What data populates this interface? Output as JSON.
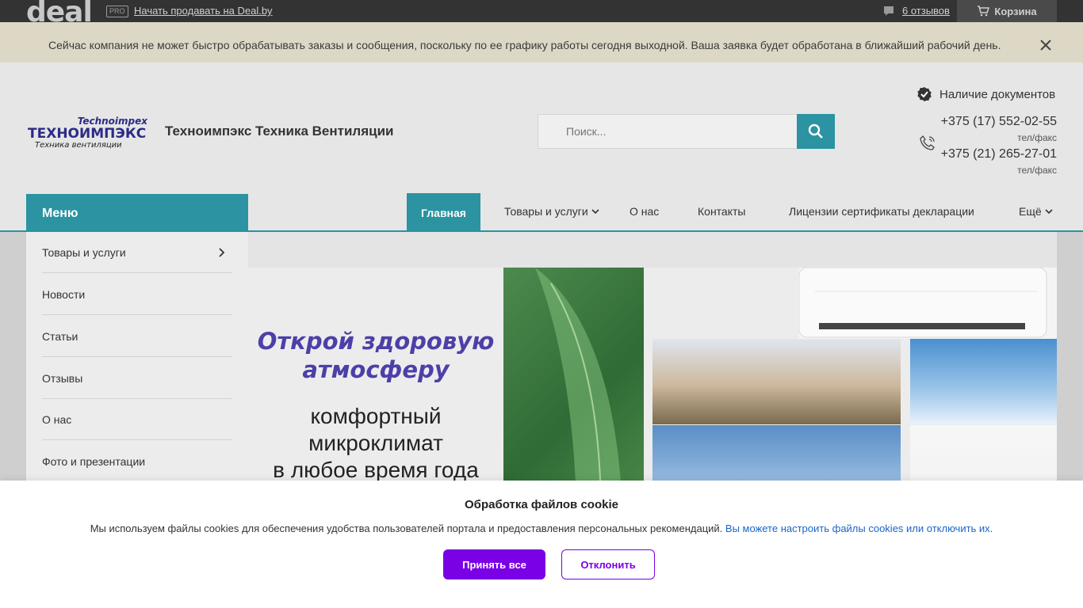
{
  "topbar": {
    "logo": "deal",
    "pro_badge": "PRO",
    "sell_link": "Начать продавать на Deal.by",
    "reviews": "6 отзывов",
    "cart": "Корзина"
  },
  "notice": {
    "text": "Сейчас компания не может быстро обрабатывать заказы и сообщения, поскольку по ее графику работы сегодня выходной. Ваша заявка будет обработана в ближайший рабочий день."
  },
  "header": {
    "logo_line1": "Technoimpex",
    "logo_line2": "ТЕХНОИМПЭКС",
    "logo_line3": "Техника вентиляции",
    "company_name": "Техноимпэкс Техника Вентиляции",
    "search_placeholder": "Поиск...",
    "docs": "Наличие документов",
    "phone1": "+375 (17) 552-02-55",
    "phone1_label": "тел/факс",
    "phone2": "+375 (21) 265-27-01",
    "phone2_label": "тел/факс"
  },
  "nav": {
    "menu": "Меню",
    "items": [
      "Главная",
      "Товары и услуги",
      "О нас",
      "Контакты",
      "Лицензии сертификаты декларации",
      "Ещё"
    ]
  },
  "sidebar": {
    "items": [
      "Товары и услуги",
      "Новости",
      "Статьи",
      "Отзывы",
      "О нас",
      "Фото и презентации"
    ]
  },
  "banner": {
    "title": "Открой здоровую атмосферу",
    "subtitle_line1": "комфортный",
    "subtitle_line2": "микроклимат",
    "subtitle_line3": "в любое время года"
  },
  "cookie": {
    "title": "Обработка файлов cookie",
    "text": "Мы используем файлы cookies для обеспечения удобства пользователей портала и предоставления персональных рекомендаций.",
    "link": "Вы можете настроить файлы cookies или отключить их.",
    "accept": "Принять все",
    "decline": "Отклонить"
  },
  "colors": {
    "accent": "#2b93a1",
    "cookie_button": "#7a00e6",
    "link": "#1a66c9"
  }
}
